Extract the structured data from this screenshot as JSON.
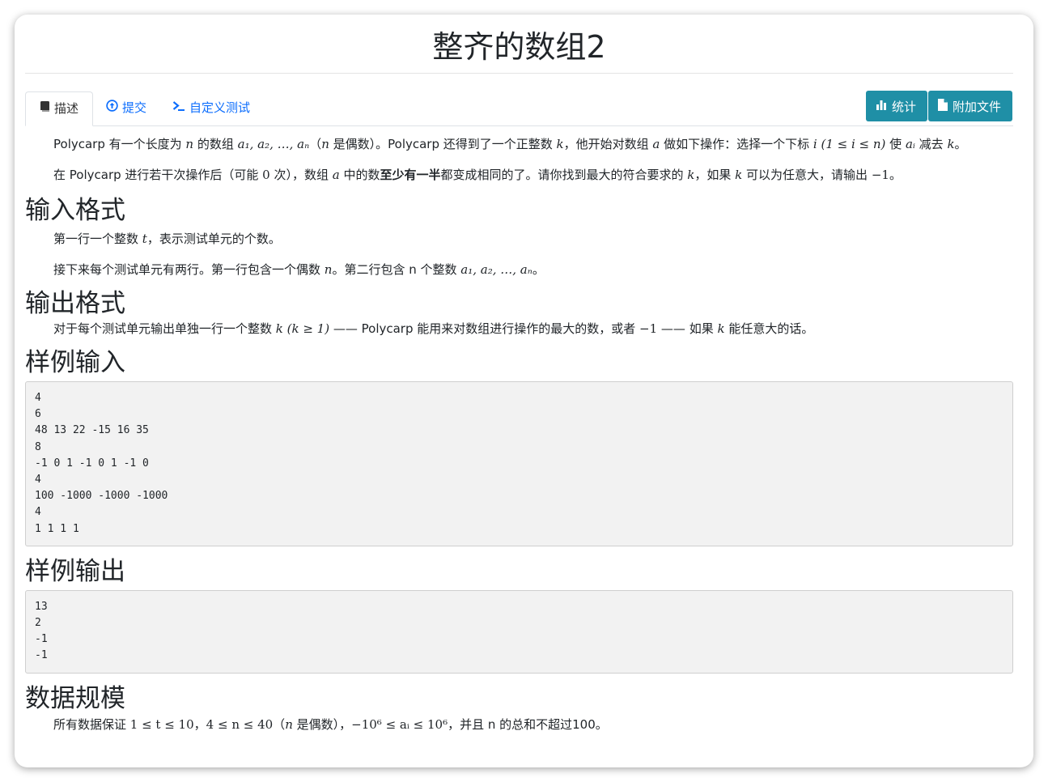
{
  "page": {
    "title": "整齐的数组2"
  },
  "tabs": [
    {
      "label": "描述",
      "icon": "book-icon",
      "active": true
    },
    {
      "label": "提交",
      "icon": "upload-circle-icon",
      "active": false
    },
    {
      "label": "自定义测试",
      "icon": "terminal-icon",
      "active": false
    }
  ],
  "actions": [
    {
      "label": "统计",
      "icon": "bar-chart-icon"
    },
    {
      "label": "附加文件",
      "icon": "file-icon"
    }
  ],
  "description": {
    "p1": {
      "t1": "Polycarp 有一个长度为 ",
      "m1": "n",
      "t2": " 的数组 ",
      "m2": "a₁, a₂, …, aₙ",
      "t3": "（",
      "m3": "n",
      "t4": " 是偶数）。Polycarp 还得到了一个正整数 ",
      "m4": "k",
      "t5": "，他开始对数组 ",
      "m5": "a",
      "t6": " 做如下操作：选择一个下标 ",
      "m6": "i (1 ≤ i ≤ n)",
      "t7": " 使 ",
      "m7": "aᵢ",
      "t8": " 减去 ",
      "m8": "k",
      "t9": "。"
    },
    "p2": {
      "t1": "在 Polycarp 进行若干次操作后（可能 ",
      "m1": "0",
      "t2": " 次），数组 ",
      "m2": "a",
      "t3": " 中的数",
      "b1": "至少有一半",
      "t4": "都变成相同的了。请你找到最大的符合要求的 ",
      "m3": "k",
      "t5": "，如果 ",
      "m4": "k",
      "t6": " 可以为任意大，请输出 ",
      "m5": "−1",
      "t7": "。"
    }
  },
  "input_format": {
    "heading": "输入格式",
    "p1": {
      "t1": "第一行一个整数 ",
      "m1": "t",
      "t2": "，表示测试单元的个数。"
    },
    "p2": {
      "t1": "接下来每个测试单元有两行。第一行包含一个偶数 ",
      "m1": "n",
      "t2": "。第二行包含 n 个整数 ",
      "m2": "a₁, a₂, …, aₙ",
      "t3": "。"
    }
  },
  "output_format": {
    "heading": "输出格式",
    "p1": {
      "t1": "对于每个测试单元输出单独一行一个整数 ",
      "m1": "k (k ≥ 1)",
      "t2": " —— Polycarp 能用来对数组进行操作的最大的数，或者 ",
      "m2": "−1",
      "t3": " —— 如果 ",
      "m3": "k",
      "t4": " 能任意大的话。"
    }
  },
  "sample_input": {
    "heading": "样例输入",
    "content": "4\n6\n48 13 22 -15 16 35\n8\n-1 0 1 -1 0 1 -1 0\n4\n100 -1000 -1000 -1000\n4\n1 1 1 1"
  },
  "sample_output": {
    "heading": "样例输出",
    "content": "13\n2\n-1\n-1"
  },
  "constraints": {
    "heading": "数据规模",
    "p1": {
      "t1": "所有数据保证 ",
      "m1": "1 ≤ t ≤ 10",
      "t2": "，",
      "m2": "4 ≤ n ≤ 40",
      "t3": "（",
      "m3": "n",
      "t4": " 是偶数），",
      "m4": "−10⁶ ≤ aᵢ ≤ 10⁶",
      "t5": "，并且 n 的总和不超过100。"
    }
  }
}
